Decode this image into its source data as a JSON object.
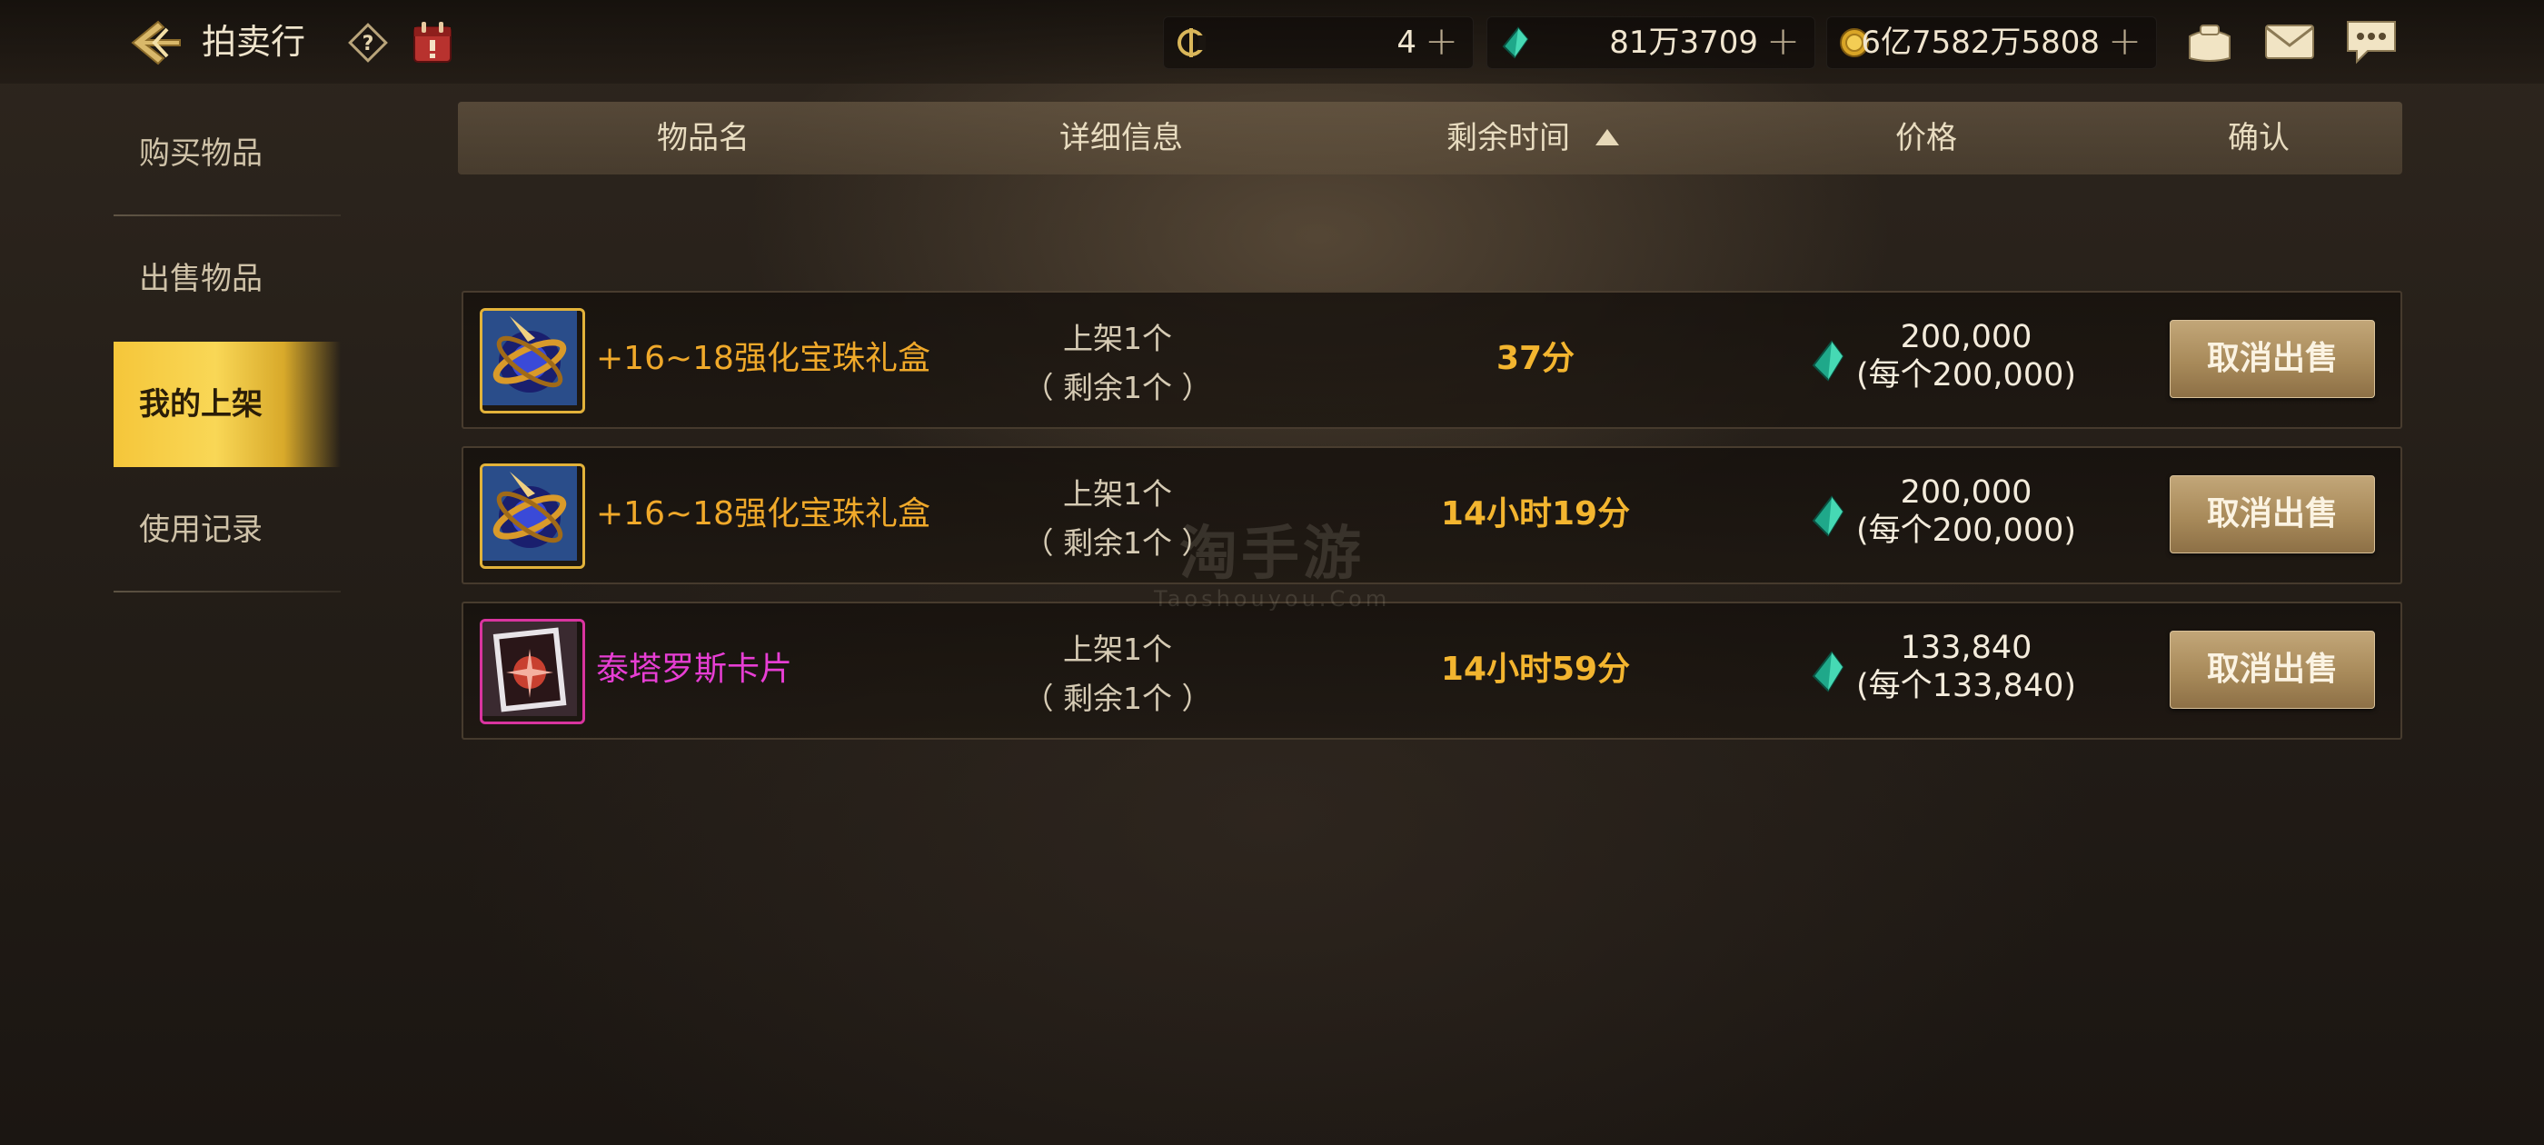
{
  "header": {
    "title": "拍卖行"
  },
  "currencies": [
    {
      "icon": "coupon-icon",
      "value": "4"
    },
    {
      "icon": "gem-icon",
      "value": "81万3709"
    },
    {
      "icon": "gold-coin-icon",
      "value": "6亿7582万5808"
    }
  ],
  "plus_symbol": "+",
  "sidebar": {
    "items": [
      {
        "label": "购买物品",
        "active": false
      },
      {
        "label": "出售物品",
        "active": false
      },
      {
        "label": "我的上架",
        "active": true
      },
      {
        "label": "使用记录",
        "active": false
      }
    ]
  },
  "table": {
    "headers": {
      "name": "物品名",
      "detail": "详细信息",
      "time": "剩余时间",
      "price": "价格",
      "confirm": "确认"
    },
    "sort": {
      "column": "time",
      "direction": "asc"
    },
    "rows": [
      {
        "icon": "orb-gift-box-icon",
        "name": "+16~18强化宝珠礼盒",
        "name_color": "#f0a92a",
        "listed": "上架1个",
        "remaining": "（ 剩余1个 ）",
        "time": "37分",
        "price": "200,000",
        "unit_price": "(每个200,000)",
        "action": "取消出售"
      },
      {
        "icon": "orb-gift-box-icon",
        "name": "+16~18强化宝珠礼盒",
        "name_color": "#f0a92a",
        "listed": "上架1个",
        "remaining": "（ 剩余1个 ）",
        "time": "14小时19分",
        "price": "200,000",
        "unit_price": "(每个200,000)",
        "action": "取消出售"
      },
      {
        "icon": "card-icon",
        "name": "泰塔罗斯卡片",
        "name_color": "#e73ed4",
        "listed": "上架1个",
        "remaining": "（ 剩余1个 ）",
        "time": "14小时59分",
        "price": "133,840",
        "unit_price": "(每个133,840)",
        "action": "取消出售"
      }
    ]
  },
  "watermark": {
    "text": "淘手游",
    "subtext": "Taoshouyou.Com"
  }
}
